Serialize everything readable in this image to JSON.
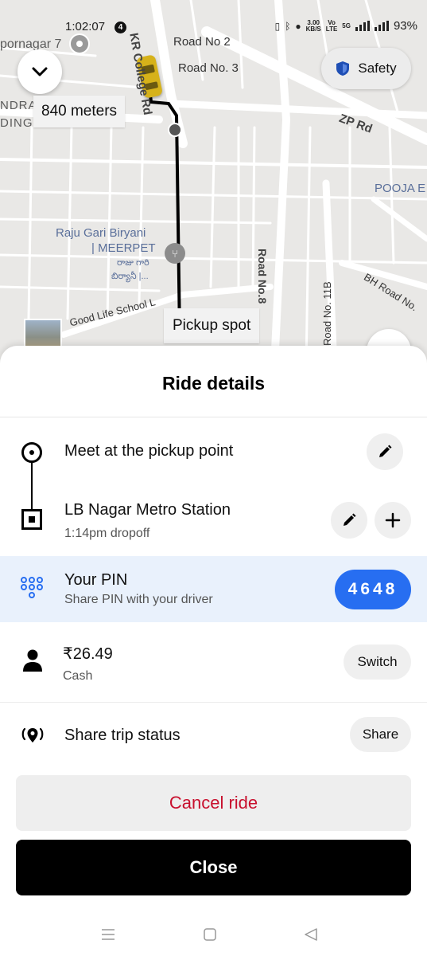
{
  "status_bar": {
    "time": "1:02:07",
    "notification_count": "4",
    "net_speed_value": "3.00",
    "net_speed_unit": "KB/S",
    "network_labels": [
      "Vo",
      "LTE"
    ],
    "network_type": "5G",
    "battery": "93%"
  },
  "map": {
    "labels": {
      "area_top": "pornagar 7",
      "area_left_1": "NDRA",
      "area_left_2": "DING A",
      "road_college": "KR College Rd",
      "road_no2": "Road No 2",
      "road_no3": "Road No. 3",
      "zp_rd": "ZP Rd",
      "pooja": "POOJA E",
      "biryani_1": "Raju Gari Biryani",
      "biryani_2": "| MEERPET",
      "biryani_te_1": "రాజు గారి",
      "biryani_te_2": "బిర్యానీ |...",
      "road_no8": "Road No.8",
      "road_no11b": "Road No. 11B",
      "bh_road": "BH Road No.",
      "school": "Good Life School L"
    },
    "distance_label": "840 meters",
    "pickup_label": "Pickup spot",
    "safety_label": "Safety"
  },
  "sheet": {
    "title": "Ride details",
    "pickup_text": "Meet at the pickup point",
    "dropoff_text": "LB Nagar Metro Station",
    "dropoff_sub": "1:14pm dropoff",
    "pin_title": "Your PIN",
    "pin_sub": "Share PIN with your driver",
    "pin_value": "4648",
    "fare": "₹26.49",
    "payment_method": "Cash",
    "switch_label": "Switch",
    "share_title": "Share trip status",
    "share_label": "Share",
    "cancel_label": "Cancel ride",
    "close_label": "Close"
  },
  "colors": {
    "accent_blue": "#276ef1",
    "cancel_red": "#c8102e",
    "pin_row_bg": "#e9f1fc",
    "map_bg": "#e9e8e6"
  },
  "icons": [
    "chevron-down-icon",
    "shield-icon",
    "pencil-icon",
    "plus-icon",
    "pin-keypad-icon",
    "person-icon",
    "share-location-icon",
    "car-icon",
    "location-pin-icon",
    "menu-icon",
    "home-square-icon",
    "back-triangle-icon"
  ]
}
